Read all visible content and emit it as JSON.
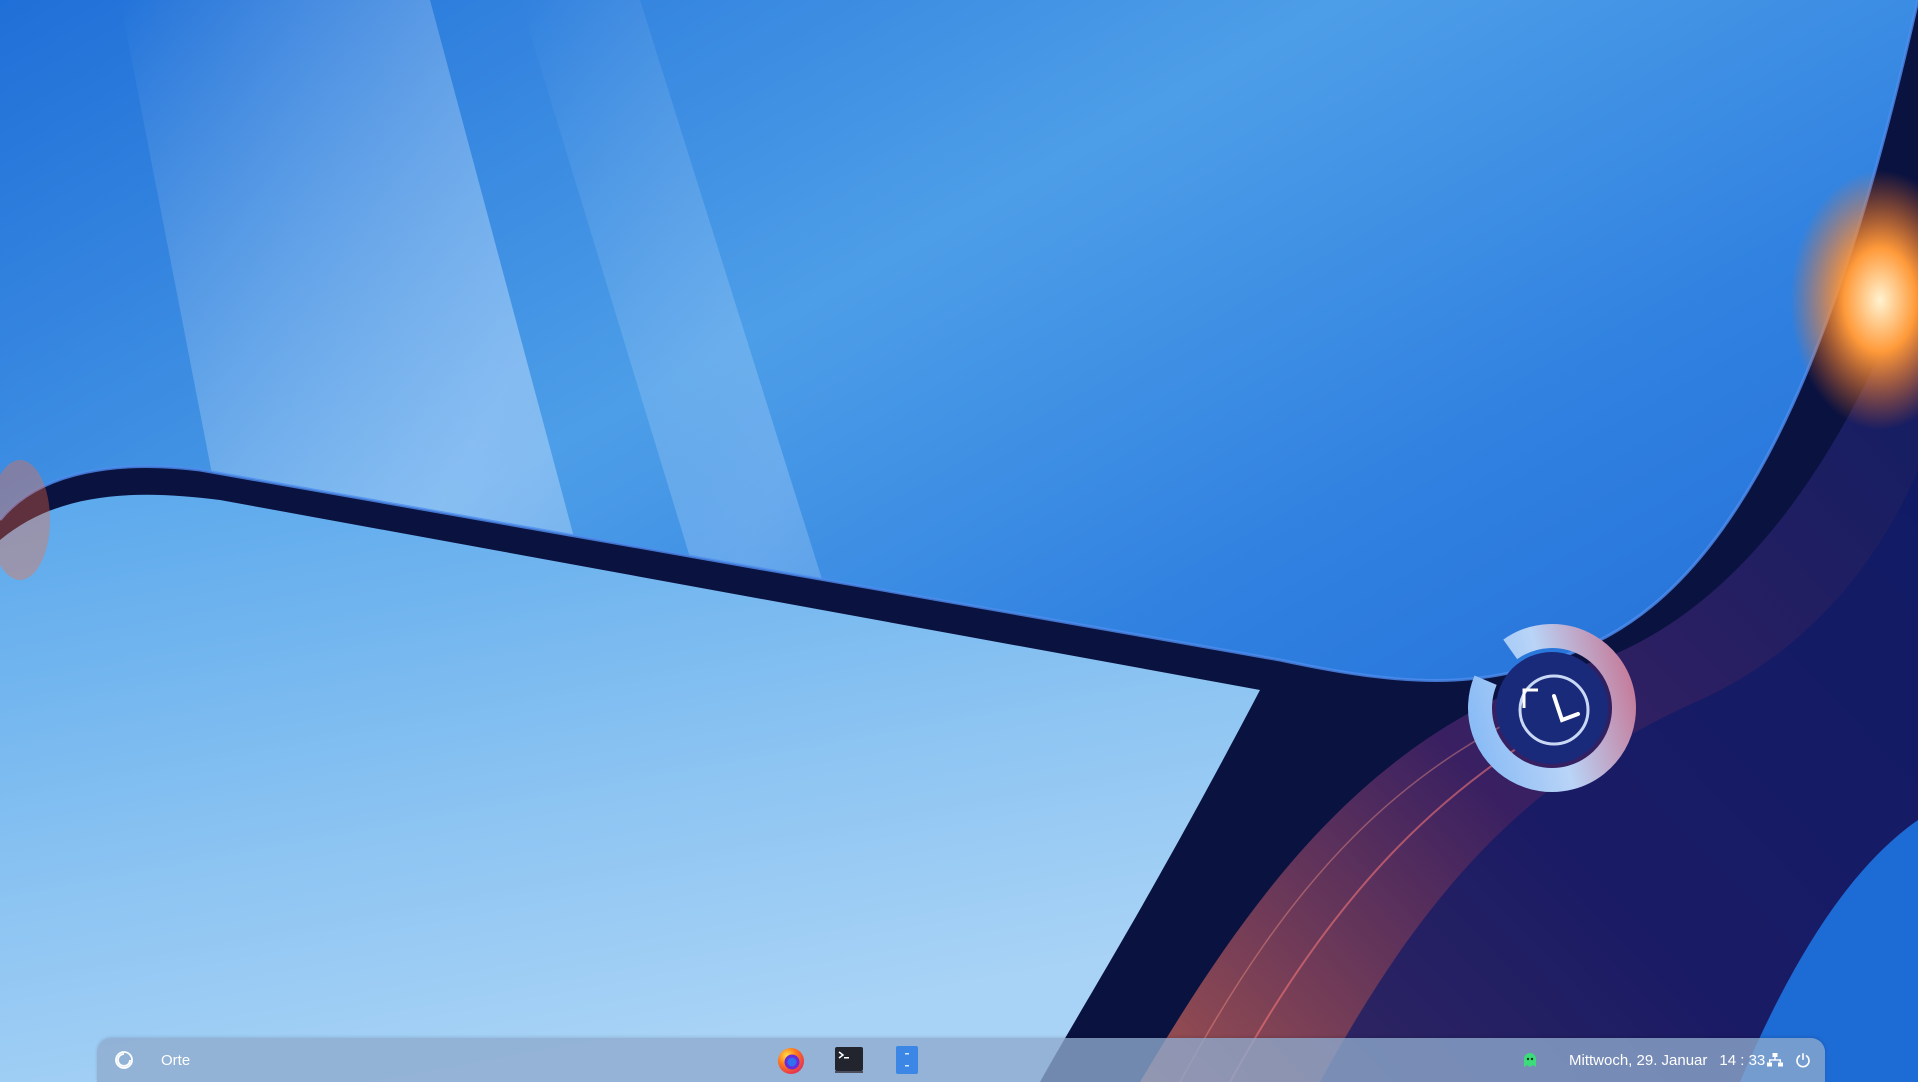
{
  "panel": {
    "places_label": "Orte",
    "clock": {
      "date": "Mittwoch, 29. Januar",
      "time": "14 : 33"
    }
  },
  "icons": {
    "activities": "activities-icon",
    "firefox": "firefox-icon",
    "terminal": "terminal-icon",
    "files": "files-icon",
    "tray": "ghost-icon",
    "network": "network-icon",
    "power": "power-icon"
  },
  "colors": {
    "panel_background": "#8eaacd",
    "panel_text": "#ffffff",
    "wallpaper_blue": "#2a7ae0",
    "wallpaper_dark": "#0a1240",
    "accent_orange": "#ff8a2a"
  }
}
